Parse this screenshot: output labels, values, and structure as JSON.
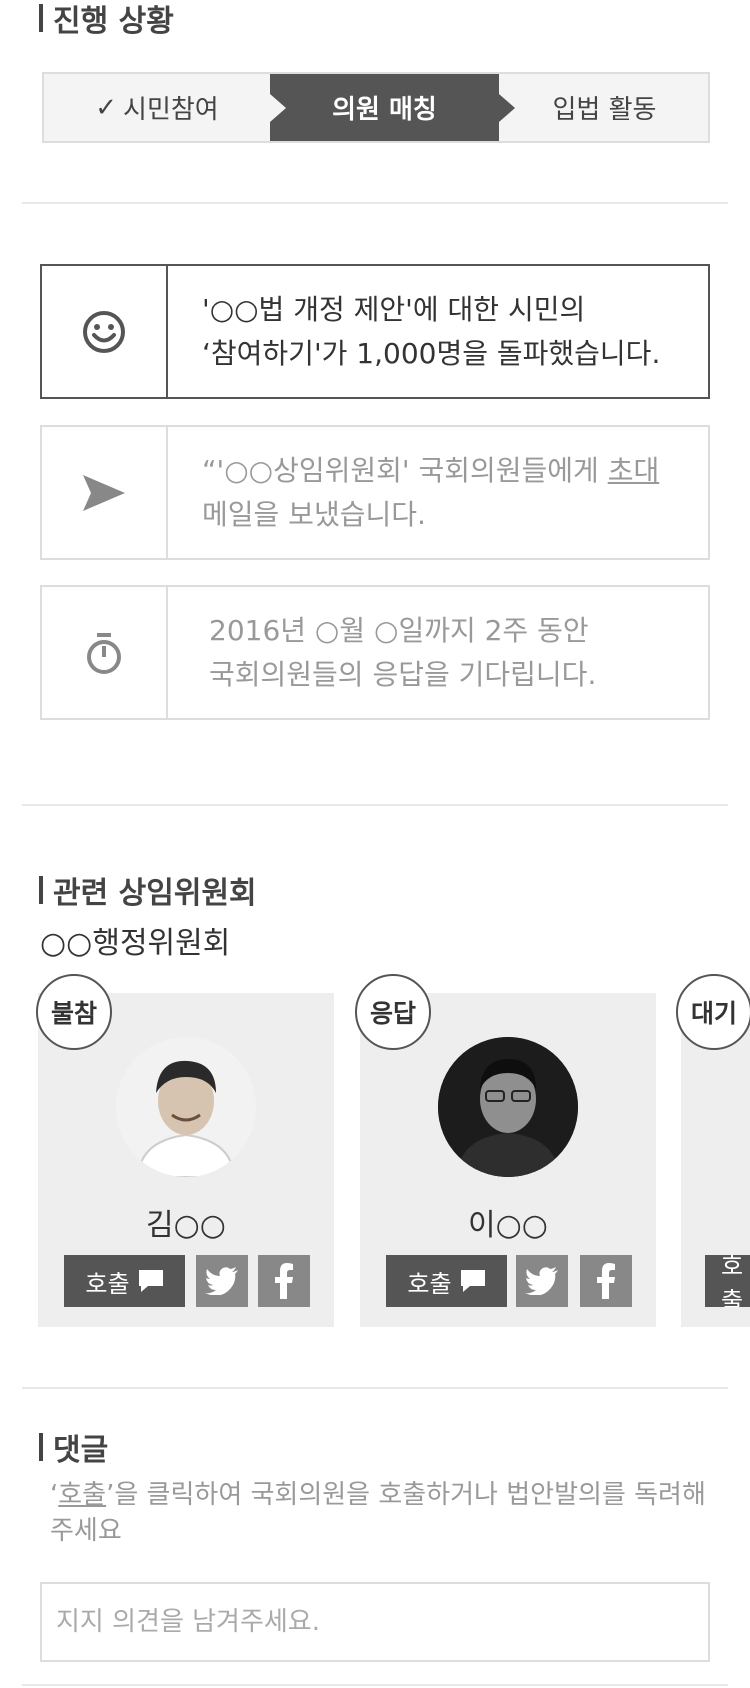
{
  "progress": {
    "title": "진행 상황",
    "steps": [
      {
        "label": "시민참여",
        "done": true
      },
      {
        "label": "의원 매칭",
        "current": true
      },
      {
        "label": "입법 활동"
      }
    ]
  },
  "timeline": [
    {
      "icon": "smile-icon",
      "line1": "'○○법 개정 제안'에 대한 시민의",
      "line2": "‘참여하기'가 1,000명을 돌파했습니다."
    },
    {
      "icon": "send-icon",
      "line1_pre": "“'○○상임위원회'  국회의원들에게 ",
      "line1_link": "초대",
      "line2": "메일을 보냈습니다."
    },
    {
      "icon": "stopwatch-icon",
      "line1": "2016년 ○월 ○일까지 2주 동안",
      "line2": "국회의원들의 응답을 기다립니다."
    }
  ],
  "committee": {
    "title": "관련 상임위원회",
    "name": "○○행정위원회",
    "members": [
      {
        "status": "불참",
        "name": "김○○",
        "call_label": "호출"
      },
      {
        "status": "응답",
        "name": "이○○",
        "call_label": "호출"
      },
      {
        "status": "대기",
        "name": "",
        "call_label": "호출"
      }
    ]
  },
  "comments": {
    "title": "댓글",
    "desc_pre": "‘",
    "desc_link": "호출",
    "desc_post": "’을 클릭하여 국회의원을 호출하거나 법안발의를 독려해 주세요",
    "placeholder": "지지 의견을 남겨주세요."
  }
}
